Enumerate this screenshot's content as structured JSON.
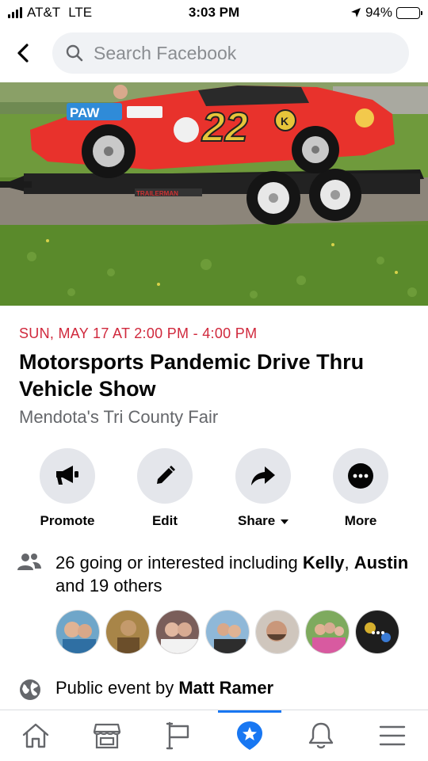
{
  "status_bar": {
    "carrier": "AT&T",
    "network": "LTE",
    "time": "3:03 PM",
    "battery": "94%"
  },
  "search": {
    "placeholder": "Search Facebook"
  },
  "cover_image": {
    "description_icon": "race-car-photo",
    "car_number": "22",
    "car_text": "PAW"
  },
  "event": {
    "date_time": "SUN, MAY 17 AT 2:00 PM - 4:00 PM",
    "title": "Motorsports Pandemic Drive Thru Vehicle Show",
    "location": "Mendota's Tri County Fair"
  },
  "actions": [
    {
      "label": "Promote",
      "icon": "megaphone-icon"
    },
    {
      "label": "Edit",
      "icon": "pencil-icon"
    },
    {
      "label": "Share",
      "icon": "share-arrow-icon"
    },
    {
      "label": "More",
      "icon": "more-dots-icon"
    }
  ],
  "attendance": {
    "count_text": "26 going or interested including ",
    "name1": "Kelly",
    "separator": ",",
    "name2": "Austin",
    "others_text": " and 19 others"
  },
  "public_event": {
    "prefix": "Public event by ",
    "host": "Matt Ramer"
  },
  "tabs": [
    {
      "name": "home-icon",
      "active": false
    },
    {
      "name": "marketplace-icon",
      "active": false
    },
    {
      "name": "pages-flag-icon",
      "active": false
    },
    {
      "name": "events-star-icon",
      "active": true
    },
    {
      "name": "notifications-bell-icon",
      "active": false
    },
    {
      "name": "menu-icon",
      "active": false
    }
  ],
  "colors": {
    "accent": "#1877f2",
    "date_red": "#d0283c",
    "secondary_text": "#65676b",
    "button_bg": "#e4e6eb"
  }
}
